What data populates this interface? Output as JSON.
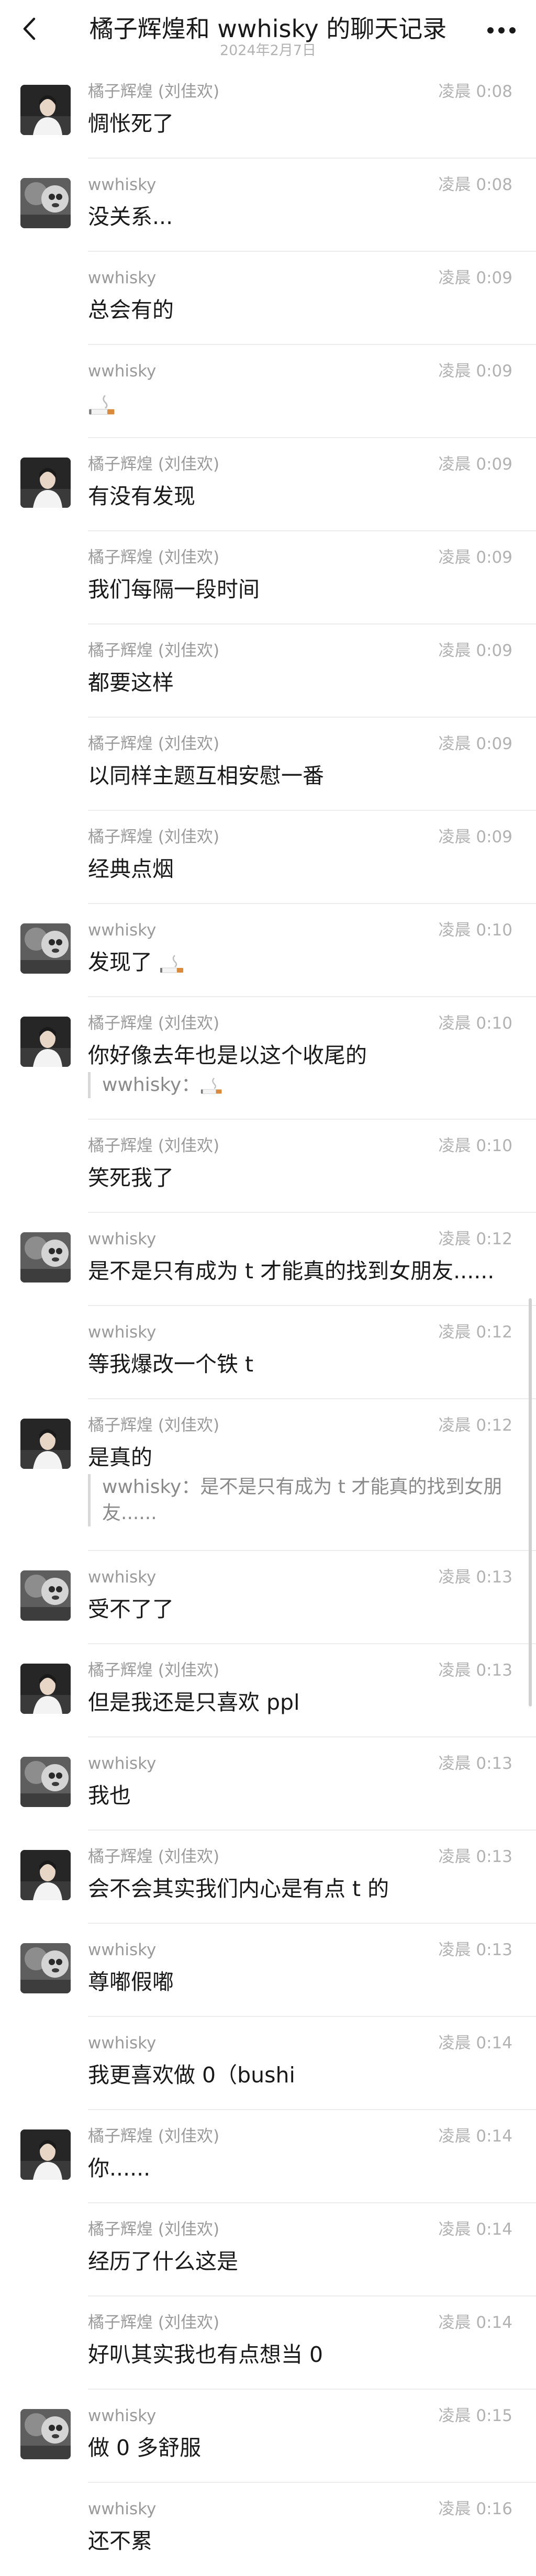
{
  "header": {
    "title": "橘子辉煌和 wwhisky 的聊天记录",
    "date": "2024年2月7日"
  },
  "messages": [
    {
      "sender": "橘子辉煌 (刘佳欢)",
      "time": "凌晨 0:08",
      "text": "惆怅死了",
      "avatar": "a"
    },
    {
      "sender": "wwhisky",
      "time": "凌晨 0:08",
      "text": "没关系...",
      "avatar": "b"
    },
    {
      "sender": "wwhisky",
      "time": "凌晨 0:09",
      "text": "总会有的",
      "avatar": ""
    },
    {
      "sender": "wwhisky",
      "time": "凌晨 0:09",
      "text": "",
      "emoji": "cigarette-emoji",
      "avatar": ""
    },
    {
      "sender": "橘子辉煌 (刘佳欢)",
      "time": "凌晨 0:09",
      "text": "有没有发现",
      "avatar": "a"
    },
    {
      "sender": "橘子辉煌 (刘佳欢)",
      "time": "凌晨 0:09",
      "text": "我们每隔一段时间",
      "avatar": ""
    },
    {
      "sender": "橘子辉煌 (刘佳欢)",
      "time": "凌晨 0:09",
      "text": "都要这样",
      "avatar": ""
    },
    {
      "sender": "橘子辉煌 (刘佳欢)",
      "time": "凌晨 0:09",
      "text": "以同样主题互相安慰一番",
      "avatar": ""
    },
    {
      "sender": "橘子辉煌 (刘佳欢)",
      "time": "凌晨 0:09",
      "text": "经典点烟",
      "avatar": ""
    },
    {
      "sender": "wwhisky",
      "time": "凌晨 0:10",
      "text": "发现了",
      "emoji": "cigarette-emoji",
      "avatar": "b"
    },
    {
      "sender": "橘子辉煌 (刘佳欢)",
      "time": "凌晨 0:10",
      "text": "你好像去年也是以这个收尾的",
      "quote": "wwhisky：",
      "quote_emoji": "cigarette-emoji",
      "avatar": "a"
    },
    {
      "sender": "橘子辉煌 (刘佳欢)",
      "time": "凌晨 0:10",
      "text": "笑死我了",
      "avatar": ""
    },
    {
      "sender": "wwhisky",
      "time": "凌晨 0:12",
      "text": "是不是只有成为 t 才能真的找到女朋友......",
      "avatar": "b"
    },
    {
      "sender": "wwhisky",
      "time": "凌晨 0:12",
      "text": "等我爆改一个铁 t",
      "avatar": ""
    },
    {
      "sender": "橘子辉煌 (刘佳欢)",
      "time": "凌晨 0:12",
      "text": "是真的",
      "quote_line1": "wwhisky：是不是只有成为 t 才能真的找到女朋",
      "quote_line2": "友......",
      "avatar": "a"
    },
    {
      "sender": "wwhisky",
      "time": "凌晨 0:13",
      "text": "受不了了",
      "avatar": "b"
    },
    {
      "sender": "橘子辉煌 (刘佳欢)",
      "time": "凌晨 0:13",
      "text": "但是我还是只喜欢 ppl",
      "avatar": "a"
    },
    {
      "sender": "wwhisky",
      "time": "凌晨 0:13",
      "text": "我也",
      "avatar": "b"
    },
    {
      "sender": "橘子辉煌 (刘佳欢)",
      "time": "凌晨 0:13",
      "text": "会不会其实我们内心是有点 t 的",
      "avatar": "a"
    },
    {
      "sender": "wwhisky",
      "time": "凌晨 0:13",
      "text": "尊嘟假嘟",
      "avatar": "b"
    },
    {
      "sender": "wwhisky",
      "time": "凌晨 0:14",
      "text": "我更喜欢做 0（bushi",
      "avatar": ""
    },
    {
      "sender": "橘子辉煌 (刘佳欢)",
      "time": "凌晨 0:14",
      "text": "你......",
      "avatar": "a"
    },
    {
      "sender": "橘子辉煌 (刘佳欢)",
      "time": "凌晨 0:14",
      "text": "经历了什么这是",
      "avatar": ""
    },
    {
      "sender": "橘子辉煌 (刘佳欢)",
      "time": "凌晨 0:14",
      "text": "好叭其实我也有点想当 0",
      "avatar": ""
    },
    {
      "sender": "wwhisky",
      "time": "凌晨 0:15",
      "text": "做 0 多舒服",
      "avatar": "b"
    },
    {
      "sender": "wwhisky",
      "time": "凌晨 0:16",
      "text": "还不累",
      "avatar": ""
    }
  ]
}
